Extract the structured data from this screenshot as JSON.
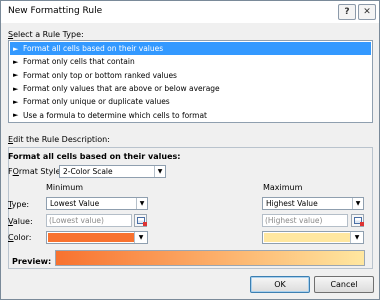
{
  "window": {
    "title": "New Formatting Rule",
    "help_glyph": "?",
    "close_glyph": "✕"
  },
  "rule_type": {
    "label": "Select a Rule Type:",
    "label_accel": "S",
    "label_rest": "elect a Rule Type:",
    "items": [
      {
        "label": "Format all cells based on their values",
        "selected": true
      },
      {
        "label": "Format only cells that contain",
        "selected": false
      },
      {
        "label": "Format only top or bottom ranked values",
        "selected": false
      },
      {
        "label": "Format only values that are above or below average",
        "selected": false
      },
      {
        "label": "Format only unique or duplicate values",
        "selected": false
      },
      {
        "label": "Use a formula to determine which cells to format",
        "selected": false
      }
    ],
    "arrow_glyph": "►"
  },
  "description": {
    "label_accel": "E",
    "label_rest": "dit the Rule Description:",
    "heading": "Format all cells based on their values:",
    "format_style_accel": "O",
    "format_style_pre": "F",
    "format_style_post": "rmat Style:",
    "format_style_value": "2-Color Scale",
    "minimum_header": "Minimum",
    "maximum_header": "Maximum",
    "type_accel": "T",
    "type_rest": "ype:",
    "value_accel": "V",
    "value_rest": "alue:",
    "color_accel": "C",
    "color_rest": "olor:",
    "min_type": "Lowest Value",
    "max_type": "Highest Value",
    "min_value": "(Lowest value)",
    "max_value": "(Highest value)",
    "min_color": "#f8722f",
    "max_color": "#ffe7a0",
    "preview_label": "Preview:"
  },
  "buttons": {
    "ok": "OK",
    "cancel": "Cancel"
  },
  "icons": {
    "dropdown": "▼"
  }
}
